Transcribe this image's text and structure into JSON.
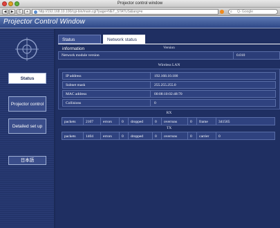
{
  "window": {
    "title": "Projector control window",
    "url": "http://192.168.10.100/cgi-bin/main.cgi?page=NET_STATUS&lang=e",
    "search_placeholder": "Q- Google",
    "nav": {
      "back": "◀",
      "forward": "▶",
      "reload": "C",
      "add": "+"
    }
  },
  "header": {
    "title": "Projector Control Window"
  },
  "sidebar": {
    "status_label": "Status",
    "projector_label": "Projector control",
    "detailed_label": "Detailed set up",
    "language_label": "日本語"
  },
  "tabs": [
    {
      "label": "Status information",
      "active": false
    },
    {
      "label": "Network status",
      "active": true
    }
  ],
  "version": {
    "title": "Version",
    "label": "Network module version",
    "value": "0.010"
  },
  "wireless": {
    "title": "Wireless LAN",
    "rows": [
      {
        "label": "IP address",
        "value": "192.168.10.100"
      },
      {
        "label": "Subnet mask",
        "value": "255.255.255.0"
      },
      {
        "label": "MAC address",
        "value": "00:08:10:02:48:70"
      },
      {
        "label": "Collisions",
        "value": "0"
      }
    ]
  },
  "rx": {
    "title": "RX",
    "cells": [
      "packets",
      "2107",
      "errors",
      "0",
      "dropped",
      "0",
      "overruns",
      "0",
      "frame",
      "341565"
    ]
  },
  "tx": {
    "title": "TX",
    "cells": [
      "packets",
      "1404",
      "errors",
      "0",
      "dropped",
      "0",
      "overruns",
      "0",
      "carrier",
      "0"
    ]
  },
  "colors": {
    "page_bg": "#1b2a57",
    "header_bg": "#2d4787",
    "active_tab": "#ffffff"
  }
}
